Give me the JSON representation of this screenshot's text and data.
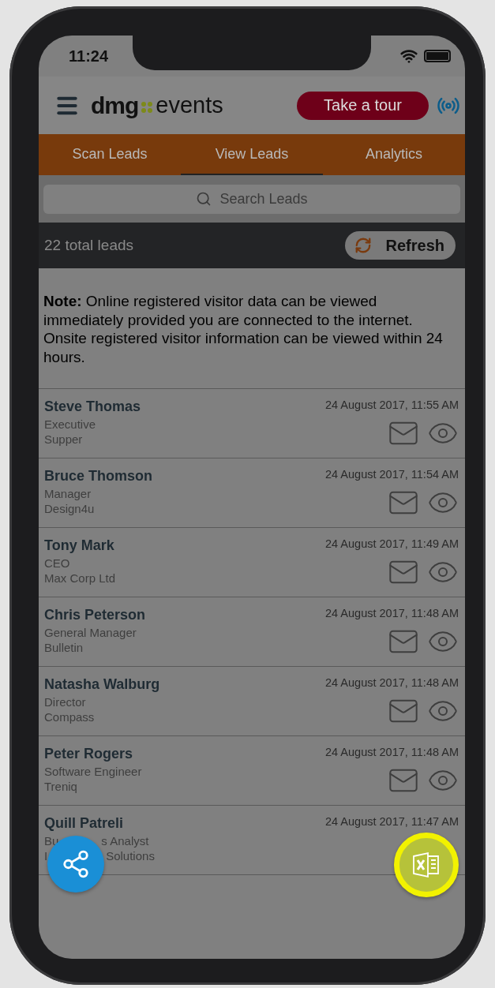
{
  "status_bar": {
    "time": "11:24"
  },
  "header": {
    "logo": {
      "brand": "dmg",
      "suffix": "events"
    },
    "tour_button": "Take a tour"
  },
  "tabs": [
    {
      "label": "Scan Leads",
      "selected": false
    },
    {
      "label": "View Leads",
      "selected": true
    },
    {
      "label": "Analytics",
      "selected": false
    }
  ],
  "search": {
    "placeholder": "Search Leads"
  },
  "summary": {
    "count": "22 total leads",
    "refresh_button": "Refresh"
  },
  "note": "**Note:** Online registered visitor data can be viewed immediately provided you are connected to the internet. Onsite registered visitor information can be viewed within 24 hours.",
  "leads": [
    {
      "name": "Steve Thomas",
      "title": [
        "Executive"
      ],
      "company": [
        "Supper"
      ],
      "date": "24 August 2017, 11:55 AM",
      "actions": true
    },
    {
      "name": "Bruce Thomson",
      "title": [
        "Manager"
      ],
      "company": [
        "Design4u"
      ],
      "date": "24 August 2017, 11:54 AM",
      "actions": true
    },
    {
      "name": "Tony Mark",
      "title": [
        "CEO"
      ],
      "company": [
        "Max Corp Ltd"
      ],
      "date": "24 August 2017, 11:49 AM",
      "actions": true
    },
    {
      "name": "Chris Peterson",
      "title": [
        "General Manager"
      ],
      "company": [
        "Bulletin"
      ],
      "date": "24 August 2017, 11:48 AM",
      "actions": true
    },
    {
      "name": "Natasha Walburg",
      "title": [
        "Director"
      ],
      "company": [
        "Compass"
      ],
      "date": "24 August 2017, 11:48 AM",
      "actions": true
    },
    {
      "name": "Peter Rogers",
      "title": [
        "Software Engineer"
      ],
      "company": [
        "Treniq"
      ],
      "date": "24 August 2017, 11:48 AM",
      "actions": true
    },
    {
      "name": "Quill Patreli",
      "title": [
        "Bu",
        "s Analyst"
      ],
      "company": [
        "I",
        "Solutions"
      ],
      "date": "24 August 2017, 11:47 AM",
      "actions": false
    }
  ],
  "fabs": [
    {
      "kind": "share"
    },
    {
      "kind": "excel",
      "highlighted": true
    }
  ]
}
